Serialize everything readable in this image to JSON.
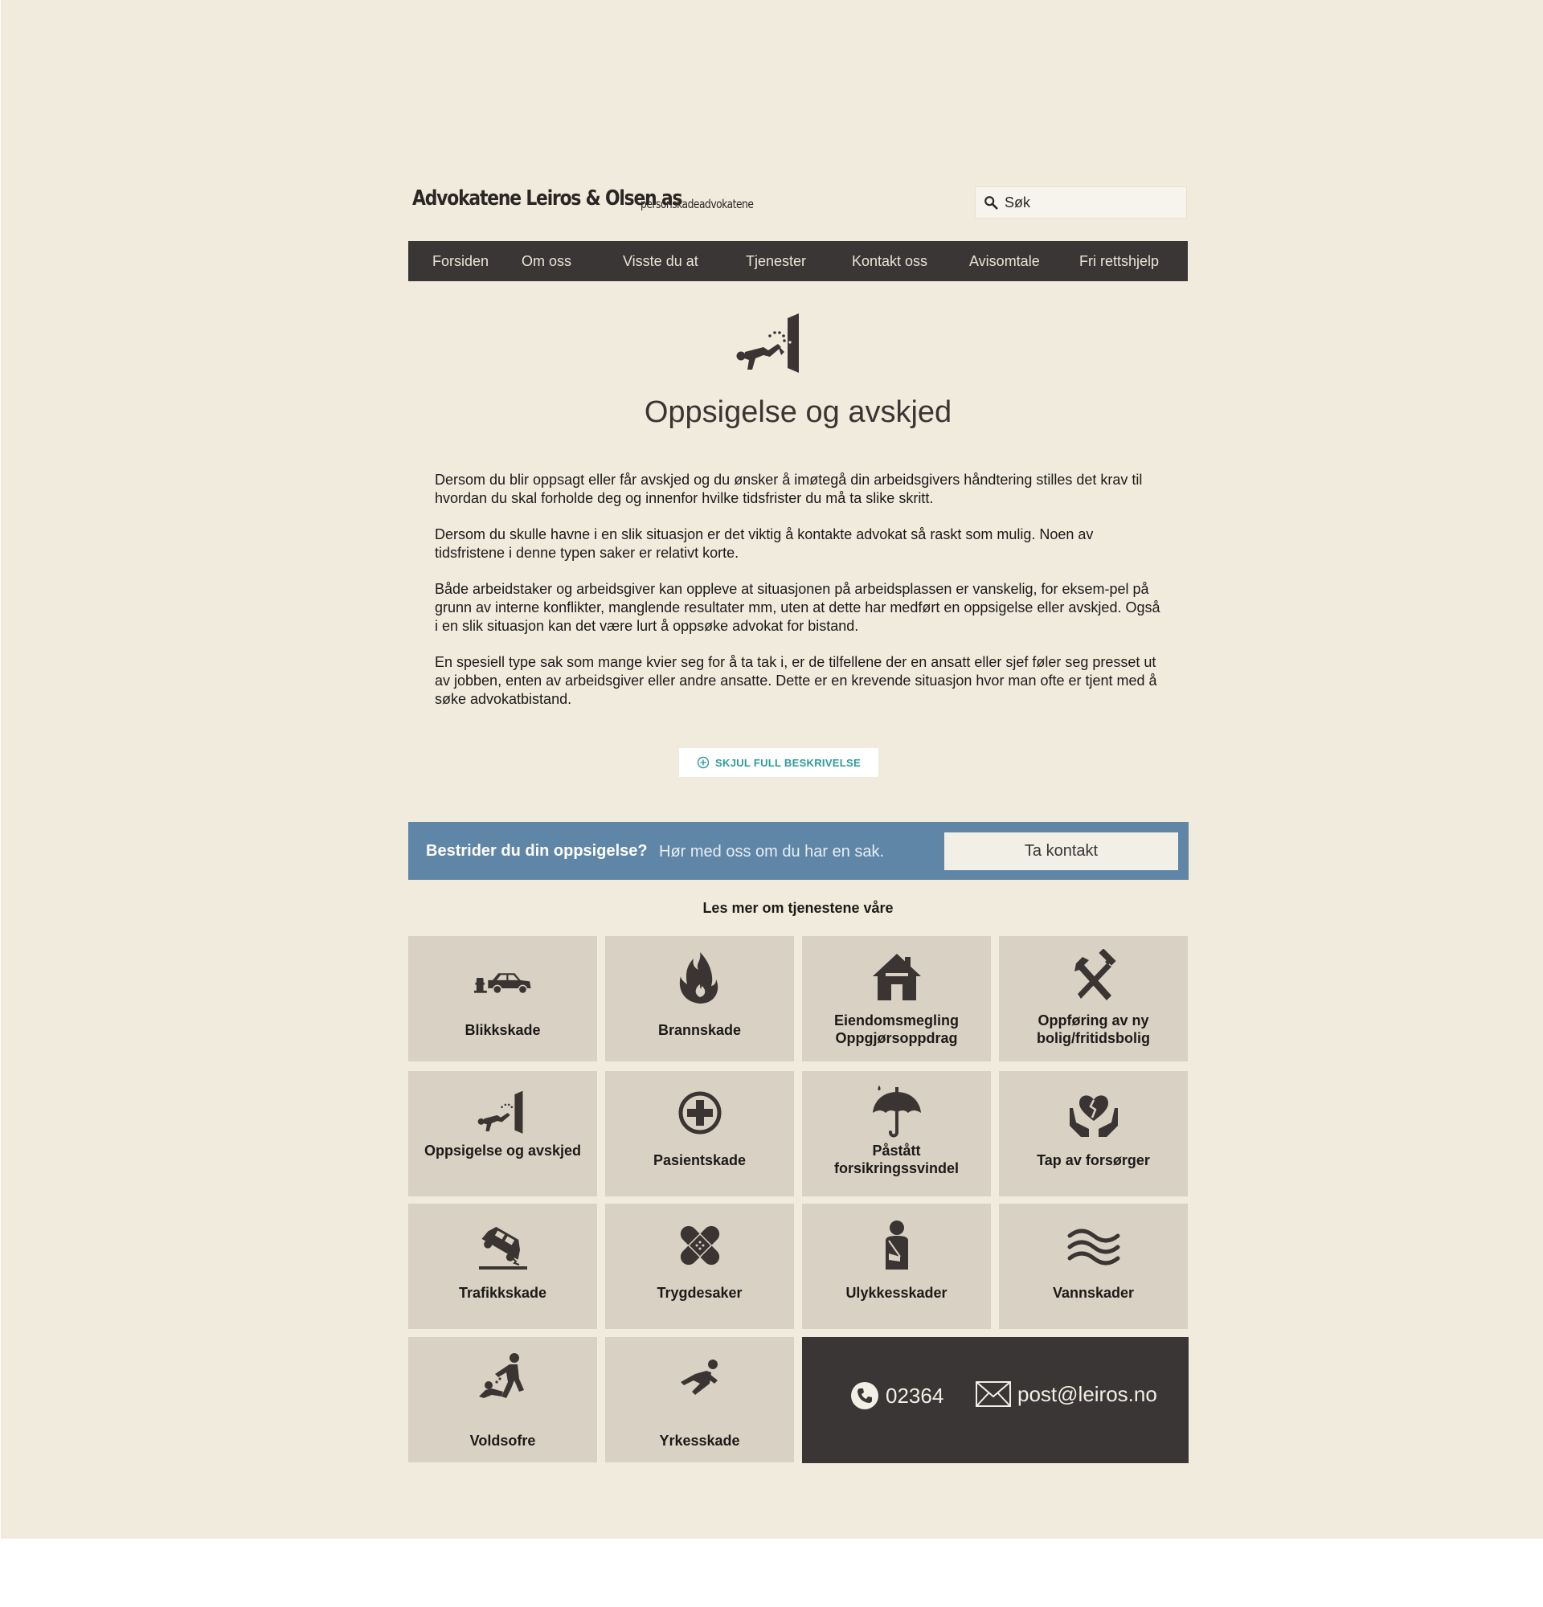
{
  "header": {
    "logo_title": "Advokatene Leiros & Olsen as",
    "logo_subtitle": "personskadeadvokatene",
    "search_placeholder": "Søk"
  },
  "nav": {
    "items": [
      "Forsiden",
      "Om oss",
      "Visste du at",
      "Tjenester",
      "Kontakt oss",
      "Avisomtale",
      "Fri rettshjelp"
    ]
  },
  "hero": {
    "icon": "dismissal-icon",
    "title": "Oppsigelse og avskjed"
  },
  "description": {
    "paragraphs": [
      "Dersom du blir oppsagt eller får avskjed og du ønsker å imøtegå din arbeidsgivers håndtering stilles det krav til hvordan du skal forholde deg og innenfor hvilke tidsfrister du må ta slike skritt.",
      "Dersom du skulle havne i en slik situasjon er det viktig å kontakte advokat så raskt som mulig. Noen av tidsfristene i denne typen saker er relativt korte.",
      "Både arbeidstaker og arbeidsgiver kan oppleve at situasjonen på arbeidsplassen er vanskelig, for eksem-pel på grunn av interne konflikter, manglende resultater mm, uten at dette har medført en oppsigelse eller avskjed. Også i en slik situasjon kan det være lurt å oppsøke advokat for bistand.",
      "En spesiell type sak som mange kvier seg for å ta tak i, er de tilfellene der en ansatt eller sjef føler seg presset ut av jobben, enten av arbeidsgiver eller andre ansatte. Dette er en krevende situasjon hvor man ofte er tjent med å søke advokatbistand."
    ],
    "toggle_label": "SKJUL FULL BESKRIVELSE"
  },
  "cta": {
    "question": "Bestrider du din oppsigelse?",
    "text": "Hør med oss om du har en sak.",
    "button": "Ta kontakt"
  },
  "services": {
    "heading": "Les mer om tjenestene våre",
    "tiles": [
      {
        "label": "Blikkskade",
        "icon": "car-crash-icon"
      },
      {
        "label": "Brannskade",
        "icon": "fire-icon"
      },
      {
        "label": "Eiendomsmegling Oppgjørsoppdrag",
        "icon": "house-icon"
      },
      {
        "label": "Oppføring av ny bolig/fritidsbolig",
        "icon": "hammer-wrench-icon"
      },
      {
        "label": "Oppsigelse og avskjed",
        "icon": "dismissal-icon"
      },
      {
        "label": "Pasientskade",
        "icon": "medical-cross-icon"
      },
      {
        "label": "Påstått forsikringssvindel",
        "icon": "umbrella-icon"
      },
      {
        "label": "Tap av forsørger",
        "icon": "broken-heart-hands-icon"
      },
      {
        "label": "Trafikkskade",
        "icon": "overturned-car-icon"
      },
      {
        "label": "Trygdesaker",
        "icon": "bandage-icon"
      },
      {
        "label": "Ulykkesskader",
        "icon": "injured-person-icon"
      },
      {
        "label": "Vannskader",
        "icon": "water-waves-icon"
      },
      {
        "label": "Voldsofre",
        "icon": "violence-icon"
      },
      {
        "label": "Yrkesskade",
        "icon": "falling-person-icon"
      }
    ]
  },
  "contact": {
    "phone": "02364",
    "email": "post@leiros.no"
  },
  "colors": {
    "background": "#f0ebdc",
    "nav": "#3b3636",
    "cta": "#5f86a7",
    "tile": "#d9d1c3",
    "toggle_text": "#2e9a9a"
  }
}
